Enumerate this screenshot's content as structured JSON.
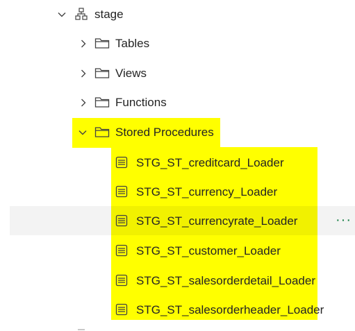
{
  "tree": {
    "schema": {
      "label": "stage",
      "expanded": true,
      "icon": "schema-icon"
    },
    "folders": [
      {
        "label": "Tables",
        "expanded": false,
        "icon": "folder-icon"
      },
      {
        "label": "Views",
        "expanded": false,
        "icon": "folder-icon"
      },
      {
        "label": "Functions",
        "expanded": false,
        "icon": "folder-icon"
      },
      {
        "label": "Stored Procedures",
        "expanded": true,
        "icon": "folder-icon"
      }
    ],
    "procedures": [
      {
        "label": "STG_ST_creditcard_Loader",
        "icon": "stored-procedure-icon"
      },
      {
        "label": "STG_ST_currency_Loader",
        "icon": "stored-procedure-icon"
      },
      {
        "label": "STG_ST_currencyrate_Loader",
        "icon": "stored-procedure-icon",
        "hovered": true
      },
      {
        "label": "STG_ST_customer_Loader",
        "icon": "stored-procedure-icon"
      },
      {
        "label": "STG_ST_salesorderdetail_Loader",
        "icon": "stored-procedure-icon"
      },
      {
        "label": "STG_ST_salesorderheader_Loader",
        "icon": "stored-procedure-icon"
      }
    ],
    "more_options": "···"
  },
  "colors": {
    "highlight": "#ffff00",
    "hover_background": "#f3f3f3",
    "more_options": "#107c41",
    "text": "#242424"
  }
}
